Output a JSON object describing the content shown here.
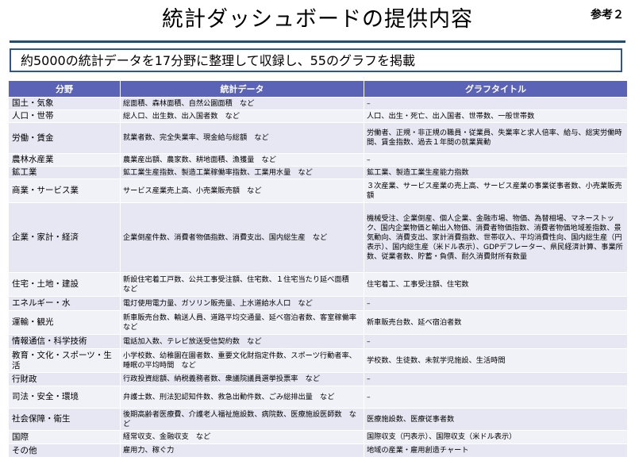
{
  "header": {
    "title": "統計ダッシュボードの提供内容",
    "reference_label": "参考２"
  },
  "summary": {
    "text": "約5000の統計データを17分野に整理して収録し、55のグラフを掲載"
  },
  "table": {
    "columns": [
      "分野",
      "統計データ",
      "グラフタイトル"
    ],
    "rows": [
      {
        "category": "国土・気象",
        "data": "総面積、森林面積、自然公園面積　など",
        "graphs": "–"
      },
      {
        "category": "人口・世帯",
        "data": "総人口、出生数、出入国者数　など",
        "graphs": "人口、出生・死亡、出入国者、世帯数、一般世帯数"
      },
      {
        "category": "労働・賃金",
        "data": "就業者数、完全失業率、現金給与総額　など",
        "graphs": "労働者、正規・非正規の職員・従業員、失業率と求人倍率、給与、総実労働時間、賃金指数、過去１年間の就業異動"
      },
      {
        "category": "農林水産業",
        "data": "農業産出額、農家数、耕地面積、漁獲量　など",
        "graphs": "–"
      },
      {
        "category": "鉱工業",
        "data": "鉱工業生産指数、製造工業稼働率指数、工業用水量　など",
        "graphs": "鉱工業、製造工業生産能力指数"
      },
      {
        "category": "商業・サービス業",
        "data": "サービス産業売上高、小売業販売額　など",
        "graphs": "３次産業、サービス産業の売上高、サービス産業の事業従事者数、小売業販売額"
      },
      {
        "category": "企業・家計・経済",
        "data": "企業倒産件数、消費者物価指数、消費支出、国内総生産　など",
        "graphs": "機械受注、企業倒産、個人企業、金融市場、物価、為替相場、マネーストック、国内企業物価と輸出入物価、消費者物価指数、消費者物価地域差指数、景気動向、消費支出、家計消費指数、世帯収入、平均消費性向、国内総生産（円表示）、国内総生産（米ドル表示）、GDPデフレーター、県民経済計算、事業所数、従業者数、貯蓄・負債、耐久消費財所有数量"
      },
      {
        "category": "住宅・土地・建設",
        "data": "新設住宅着工戸数、公共工事受注額、住宅数、１住宅当たり延べ面積　など",
        "graphs": "住宅着工、工事受注額、住宅数"
      },
      {
        "category": "エネルギー・水",
        "data": "電灯使用電力量、ガソリン販売量、上水道給水人口　など",
        "graphs": "–"
      },
      {
        "category": "運輸・観光",
        "data": "新車販売台数、輸送人員、道路平均交通量、延べ宿泊者数、客室稼働率　など",
        "graphs": "新車販売台数、延べ宿泊者数"
      },
      {
        "category": "情報通信・科学技術",
        "data": "電話加入数、テレビ放送受信契約数　など",
        "graphs": "–"
      },
      {
        "category": "教育・文化・スポーツ・生活",
        "data": "小学校数、幼稚園在園者数、重要文化財指定件数、スポーツ行動者率、睡眠の平均時間　など",
        "graphs": "学校数、生徒数、未就学児施設、生活時間"
      },
      {
        "category": "行財政",
        "data": "行政投資総額、納税義務者数、衆議院議員選挙投票率　など",
        "graphs": "–"
      },
      {
        "category": "司法・安全・環境",
        "data": "弁護士数、刑法犯認知件数、救急出動件数、ごみ総排出量　など",
        "graphs": "–"
      },
      {
        "category": "社会保障・衛生",
        "data": "後期高齢者医療費、介護老人福祉施設数、病院数、医療施設医師数　など",
        "graphs": "医療施設数、医療従事者数"
      },
      {
        "category": "国際",
        "data": "経常収支、金融収支　など",
        "graphs": "国際収支（円表示）、国際収支（米ドル表示）"
      },
      {
        "category": "その他",
        "data": "雇用力、稼ぐ力",
        "graphs": "地域の産業・雇用創造チャート"
      }
    ]
  }
}
